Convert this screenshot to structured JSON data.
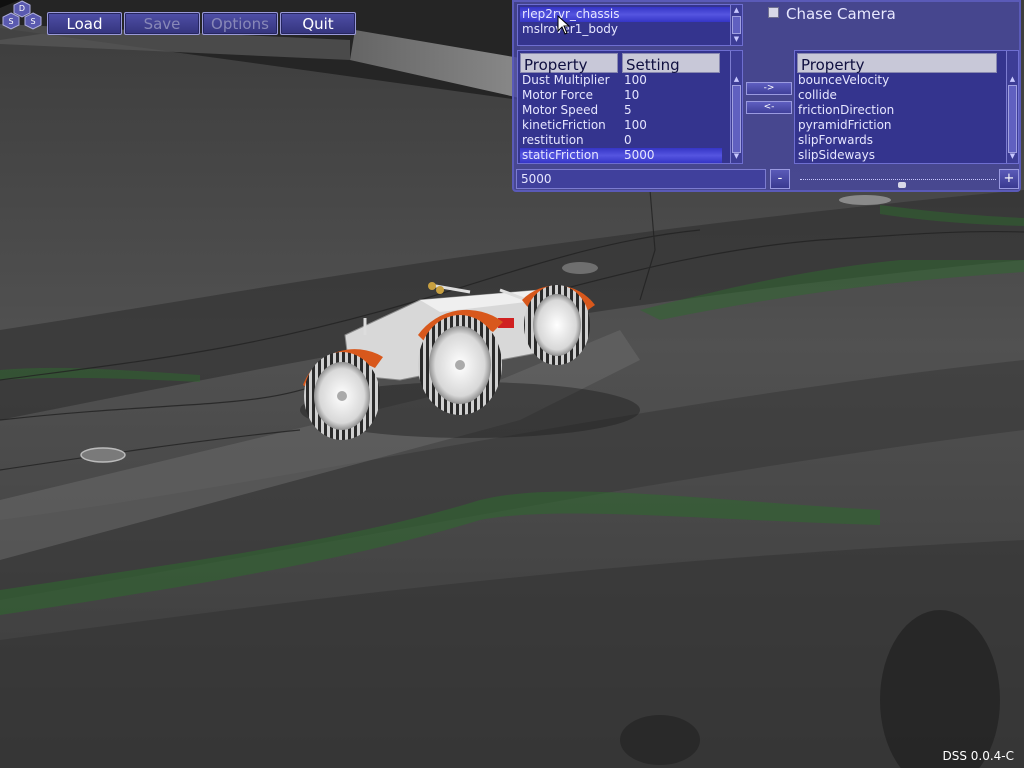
{
  "toolbar": {
    "buttons": [
      {
        "label": "Load",
        "enabled": true
      },
      {
        "label": "Save",
        "enabled": false
      },
      {
        "label": "Options",
        "enabled": false
      },
      {
        "label": "Quit",
        "enabled": true
      }
    ]
  },
  "logo": {
    "letters": [
      "D",
      "S",
      "S"
    ]
  },
  "objects_list": {
    "items": [
      "rlep2rvr_chassis",
      "mslrover1_body"
    ],
    "selected_index": 0
  },
  "settings_table": {
    "columns": [
      "Property",
      "Setting"
    ],
    "rows": [
      {
        "property": "Dust Multiplier",
        "setting": "100"
      },
      {
        "property": "Motor Force",
        "setting": "10"
      },
      {
        "property": "Motor Speed",
        "setting": "5"
      },
      {
        "property": "kineticFriction",
        "setting": "100"
      },
      {
        "property": "restitution",
        "setting": "0"
      },
      {
        "property": "staticFriction",
        "setting": "5000"
      }
    ],
    "selected_index": 5
  },
  "transfer": {
    "add_label": "->",
    "remove_label": "<-"
  },
  "available_properties": {
    "column": "Property",
    "items": [
      "bounceVelocity",
      "collide",
      "frictionDirection",
      "pyramidFriction",
      "slipForwards",
      "slipSideways"
    ]
  },
  "chase_camera": {
    "label": "Chase Camera",
    "checked": false
  },
  "value_editor": {
    "value": "5000",
    "minus_label": "-",
    "plus_label": "+",
    "slider_fraction": 0.52
  },
  "version": "DSS 0.0.4-C",
  "colors": {
    "panel": "#4848a0",
    "selection": "#3a3ad0",
    "fender": "#d8581c",
    "terrain": "#4a4a4a",
    "moss": "#2e6a2e"
  }
}
